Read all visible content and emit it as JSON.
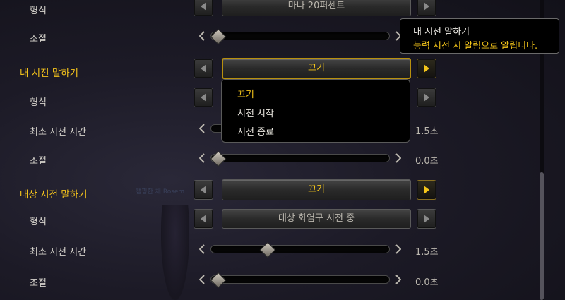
{
  "rows": [
    {
      "label": "형식",
      "type": "dropdown",
      "value": "마나 20퍼센트"
    },
    {
      "label": "조절",
      "type": "slider",
      "level": 0.0
    },
    {
      "label": "내 시전 말하기",
      "type": "dropdown",
      "section": true,
      "value": "끄기"
    },
    {
      "label": "형식",
      "type": "dropdown",
      "value": ""
    },
    {
      "label": "최소 시전 시간",
      "type": "slider",
      "value": "1.5초"
    },
    {
      "label": "조절",
      "type": "slider",
      "value": "0.0초",
      "level": 0.0
    },
    {
      "label": "대상 시전 말하기",
      "type": "dropdown",
      "section": true,
      "value": "끄기"
    },
    {
      "label": "형식",
      "type": "dropdown",
      "value": "대상 화염구 시전 중"
    },
    {
      "label": "최소 시전 시간",
      "type": "slider",
      "value": "1.5초",
      "level": 0.3
    },
    {
      "label": "조절",
      "type": "slider",
      "value": "0.0초",
      "level": 0.0
    }
  ],
  "menu": {
    "options": [
      "끄기",
      "시전 시작",
      "시전 종료"
    ],
    "selected": "끄기"
  },
  "tooltip": {
    "title": "내 시전 말하기",
    "text": "능력 시전 시 알림으로 알립니다."
  },
  "ghost_text": "캠핑한 채 Rosem",
  "colors": {
    "accent": "#f4c51a",
    "label": "#d6d3cc",
    "background": "#1c1a26"
  }
}
